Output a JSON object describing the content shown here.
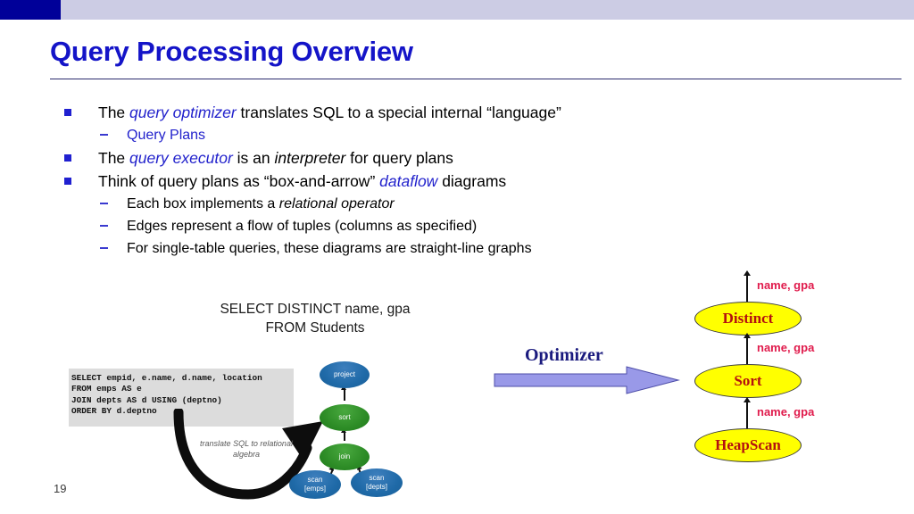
{
  "header": {
    "accent_color": "#000099",
    "bar_color": "#ccccE4"
  },
  "title": "Query Processing Overview",
  "title_color": "#1414c8",
  "bullets": [
    {
      "level": 1,
      "parts": [
        {
          "text": "The ",
          "style": "plain"
        },
        {
          "text": "query optimizer",
          "style": "em-blue"
        },
        {
          "text": " translates SQL to a special internal “language”",
          "style": "plain"
        }
      ]
    },
    {
      "level": 2,
      "parts": [
        {
          "text": "Query Plans",
          "style": "blue-plain"
        }
      ]
    },
    {
      "level": 1,
      "parts": [
        {
          "text": "The ",
          "style": "plain"
        },
        {
          "text": "query executor",
          "style": "em-blue"
        },
        {
          "text": " is an ",
          "style": "plain"
        },
        {
          "text": "interpreter",
          "style": "em-black"
        },
        {
          "text": " for query plans",
          "style": "plain"
        }
      ]
    },
    {
      "level": 1,
      "parts": [
        {
          "text": "Think of query plans as “box-and-arrow” ",
          "style": "plain"
        },
        {
          "text": "dataflow",
          "style": "em-blue"
        },
        {
          "text": " diagrams",
          "style": "plain"
        }
      ]
    },
    {
      "level": 2,
      "parts": [
        {
          "text": "Each box implements a ",
          "style": "plain"
        },
        {
          "text": "relational operator",
          "style": "em-black"
        }
      ]
    },
    {
      "level": 2,
      "parts": [
        {
          "text": "Edges represent a flow of tuples (columns as specified)",
          "style": "plain"
        }
      ]
    },
    {
      "level": 2,
      "parts": [
        {
          "text": "For single-table queries, these diagrams are straight-line graphs",
          "style": "plain"
        }
      ]
    }
  ],
  "sql_caption": {
    "line1": "SELECT DISTINCT name, gpa",
    "line2": "FROM Students"
  },
  "left_figure": {
    "sql_code": "SELECT empid, e.name, d.name, location\nFROM emps AS e\nJOIN depts AS d USING (deptno)\nORDER BY d.deptno",
    "translate_label": "translate SQL to relational algebra",
    "nodes": [
      {
        "id": "project",
        "label": "project",
        "color": "blue"
      },
      {
        "id": "sort",
        "label": "sort",
        "color": "green"
      },
      {
        "id": "join",
        "label": "join",
        "color": "green"
      },
      {
        "id": "scan-emps",
        "label_line1": "scan",
        "label_line2": "[emps]",
        "color": "blue"
      },
      {
        "id": "scan-depts",
        "label_line1": "scan",
        "label_line2": "[depts]",
        "color": "blue"
      }
    ]
  },
  "optimizer": {
    "label": "Optimizer",
    "label_color": "#1a1a7e",
    "arrow_color": "#9999e8"
  },
  "right_plan": {
    "node_fill": "#ffff00",
    "node_text_color": "#b41010",
    "label_color": "#e01b4c",
    "nodes": [
      {
        "id": "distinct",
        "label": "Distinct"
      },
      {
        "id": "sort",
        "label": "Sort"
      },
      {
        "id": "heapscan",
        "label": "HeapScan"
      }
    ],
    "edge_labels": {
      "top": "name, gpa",
      "mid": "name, gpa",
      "bottom": "name, gpa"
    }
  },
  "slide_number": "19"
}
